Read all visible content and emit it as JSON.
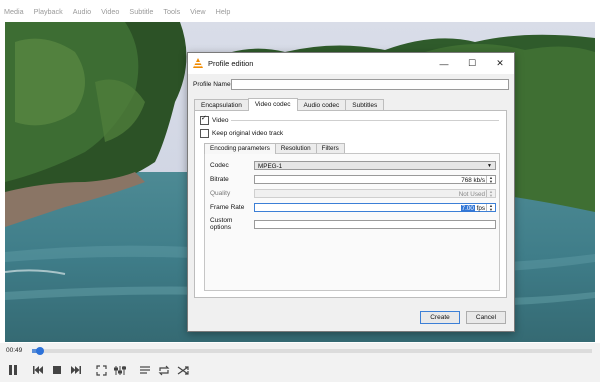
{
  "menubar": [
    "Media",
    "Playback",
    "Audio",
    "Video",
    "Subtitle",
    "Tools",
    "View",
    "Help"
  ],
  "player": {
    "time": "00:49",
    "progress": 0.015,
    "icons": [
      "pause-icon",
      "previous-icon",
      "stop-icon",
      "next-icon",
      "fullscreen-icon",
      "extended-settings-icon",
      "playlist-icon",
      "loop-icon",
      "shuffle-icon"
    ]
  },
  "dialog": {
    "title": "Profile edition",
    "profile_name_label": "Profile Name",
    "profile_name_value": "",
    "tabs": [
      "Encapsulation",
      "Video codec",
      "Audio codec",
      "Subtitles"
    ],
    "active_tab": "Video codec",
    "video_label": "Video",
    "video_checked": true,
    "keep_original_label": "Keep original video track",
    "keep_original_checked": false,
    "subtabs": [
      "Encoding parameters",
      "Resolution",
      "Filters"
    ],
    "active_subtab": "Encoding parameters",
    "codec_label": "Codec",
    "codec_value": "MPEG-1",
    "bitrate_label": "Bitrate",
    "bitrate_value": "768 kb/s",
    "quality_label": "Quality",
    "quality_value": "Not Used",
    "framerate_label": "Frame Rate",
    "framerate_number": "7.00",
    "framerate_unit": " fps",
    "custom_options_label": "Custom options",
    "custom_options_value": "",
    "create_label": "Create",
    "cancel_label": "Cancel",
    "window_buttons": {
      "minimize": "—",
      "maximize": "☐",
      "close": "✕"
    }
  }
}
